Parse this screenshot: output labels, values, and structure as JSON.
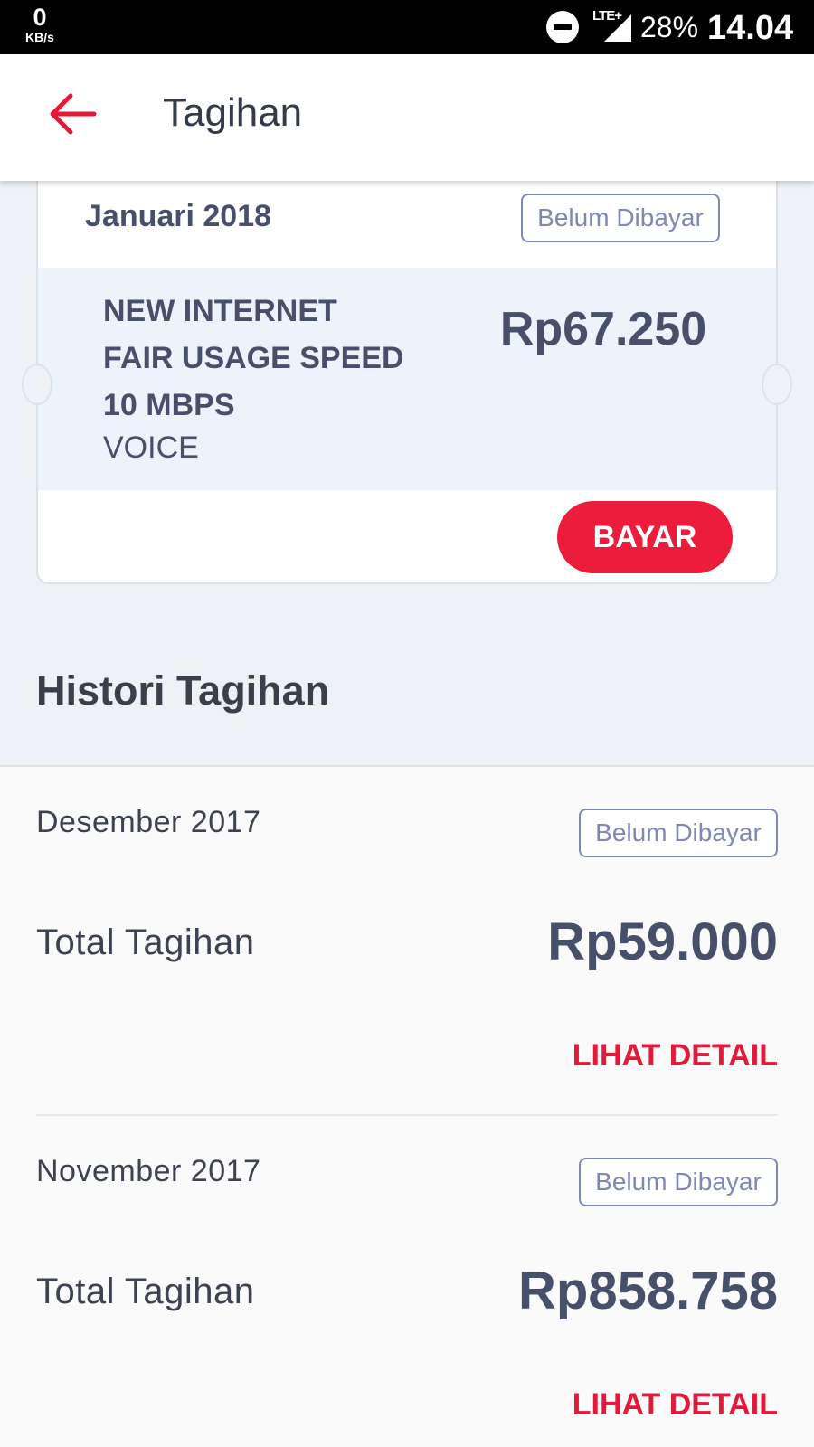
{
  "status_bar": {
    "net_speed_value": "0",
    "net_speed_unit": "KB/s",
    "network_type": "LTE+",
    "battery": "28%",
    "time": "14.04",
    "icons": [
      "do-not-disturb-icon",
      "signal-icon"
    ]
  },
  "app_bar": {
    "title": "Tagihan",
    "back_icon": "arrow-left-icon",
    "accent_color": "#E3193A"
  },
  "current_bill": {
    "month": "Januari 2018",
    "status": "Belum Dibayar",
    "package_lines": [
      "NEW INTERNET",
      "FAIR USAGE SPEED",
      "10 MBPS"
    ],
    "package_type": "VOICE",
    "amount": "Rp67.250",
    "pay_label": "BAYAR"
  },
  "history": {
    "heading": "Histori Tagihan",
    "items": [
      {
        "month": "Desember 2017",
        "status": "Belum Dibayar",
        "total_label": "Total Tagihan",
        "amount": "Rp59.000",
        "detail_label": "LIHAT DETAIL"
      },
      {
        "month": "November 2017",
        "status": "Belum Dibayar",
        "total_label": "Total Tagihan",
        "amount": "Rp858.758",
        "detail_label": "LIHAT DETAIL"
      }
    ]
  }
}
